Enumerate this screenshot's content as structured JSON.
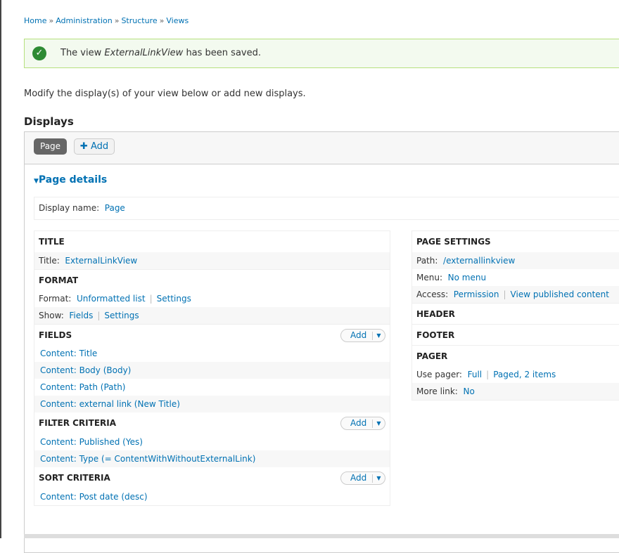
{
  "breadcrumb": [
    "Home",
    "Administration",
    "Structure",
    "Views"
  ],
  "message": {
    "prefix": "The view ",
    "view_name": "ExternalLinkView",
    "suffix": " has been saved."
  },
  "intro": "Modify the display(s) of your view below or add new displays.",
  "displays_heading": "Displays",
  "tabs": {
    "page": "Page",
    "add": "Add"
  },
  "page_details": "Page details",
  "display_name": {
    "label": "Display name:",
    "value": "Page"
  },
  "left": {
    "title": {
      "heading": "TITLE",
      "label": "Title:",
      "value": "ExternalLinkView"
    },
    "format": {
      "heading": "FORMAT",
      "format_label": "Format:",
      "format_value": "Unformatted list",
      "format_settings": "Settings",
      "show_label": "Show:",
      "show_value": "Fields",
      "show_settings": "Settings"
    },
    "fields": {
      "heading": "FIELDS",
      "add": "Add",
      "items": [
        "Content: Title",
        "Content: Body (Body)",
        "Content: Path (Path)",
        "Content: external link (New Title)"
      ]
    },
    "filter": {
      "heading": "FILTER CRITERIA",
      "add": "Add",
      "items": [
        "Content: Published (Yes)",
        "Content: Type (= ContentWithWithoutExternalLink)"
      ]
    },
    "sort": {
      "heading": "SORT CRITERIA",
      "add": "Add",
      "items": [
        "Content: Post date (desc)"
      ]
    }
  },
  "right": {
    "page_settings": {
      "heading": "PAGE SETTINGS",
      "path_label": "Path:",
      "path_value": "/externallinkview",
      "menu_label": "Menu:",
      "menu_value": "No menu",
      "access_label": "Access:",
      "access_value": "Permission",
      "access_value2": "View published content"
    },
    "header": "HEADER",
    "footer": "FOOTER",
    "pager": {
      "heading": "PAGER",
      "use_label": "Use pager:",
      "use_value": "Full",
      "use_value2": "Paged, 2 items",
      "more_label": "More link:",
      "more_value": "No"
    }
  }
}
